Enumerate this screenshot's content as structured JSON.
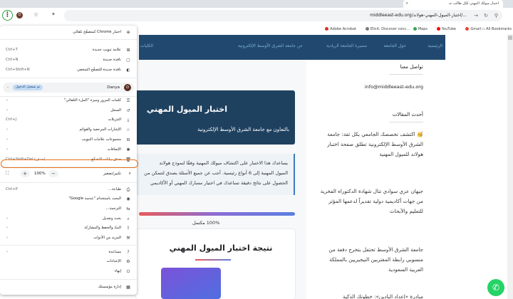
{
  "browser": {
    "tab_title": "اختبار ميولك المهني لكل طالب جـ",
    "tab_close": "×",
    "url": "middleeast-edu.org/اختبار-الميول-المهني-هولاند/...",
    "menu_icon": "⋮",
    "avatar_letter": "D",
    "bookmarks": [
      {
        "label": "All Bookmarks",
        "icon": "folder-icon"
      },
      {
        "label": "Gmail",
        "color": "#ea4335"
      },
      {
        "label": "YouTube",
        "color": "#ff0000"
      },
      {
        "label": "Maps",
        "color": "#34a853"
      },
      {
        "label": "Elicit: Discover conc...",
        "color": "#7a7a7a"
      },
      {
        "label": "Adobe Acrobat",
        "color": "#d93025"
      }
    ]
  },
  "site": {
    "nav": [
      "الرئيسية",
      "حول الجامعة",
      "مسيرة الجامعة الريادية",
      "عن جامعة الشرق الأوسط الإلكترونية",
      "الكليات"
    ],
    "hero_title": "اختبار الميول المهني",
    "hero_subtitle": "بالتعاون مع جامعة الشرق الأوسط الإلكترونية",
    "intro_lines": [
      "يساعدك هذا الاختبار على اكتشاف ميولك المهنية وفقًا لنموذج هولاند",
      "الميول المهنية إلى 6 أنواع رئيسية. أجب عن جميع الأسئلة بصدق لتتمكن من",
      "الحصول على نتائج دقيقة تساعدك في اختيار مسارك المهني أو الأكاديمي"
    ],
    "progress_label": "100% مكتمل",
    "progress_percent": 100,
    "result_title": "نتيجة اختبار الميول المهني"
  },
  "sidebar": {
    "contact_title": "تواصل معنا",
    "email": "info@middleeast-edu.org",
    "recent_title": "أحدث المقالات",
    "articles": [
      "🥳 اكتشف تخصصك الجامعي بكل ثقة: جامعة الشرق الأوسط الإلكترونية تطلق صفحة اختبار هولاند للميول المهنية",
      "جيهان عزي سوادي تنال شهادة الدكتوراه الفخرية من جهات أكاديمية دولية تقديراً لدعمها المؤثر للتعليم والأبحاث",
      "جامعة الشرق الأوسط تحتفل بتخرج دفعة من منسوبي رابطة المغتربين النيجيريين بالمملكة العربية السعودية",
      "مبادرة «إعداد البادين»: خطوتك الذكية"
    ]
  },
  "chrome_menu": {
    "items": [
      {
        "label": "اختيار Chrome كمتصفّح تلقائي",
        "icon": "⊕",
        "shortcut": ""
      },
      {
        "label": "علامة تبويب جديدة",
        "icon": "⊞",
        "shortcut": "Ctrl+T"
      },
      {
        "label": "نافذة جديدة",
        "icon": "▢",
        "shortcut": "Ctrl+N"
      },
      {
        "label": "نافذة جديدة للتصفّح المتخفي",
        "icon": "◐",
        "shortcut": "Ctrl+Shift+N"
      },
      {
        "label": "كلمات المرور وميزة \"الملء التلقائي\"",
        "icon": "⚿",
        "chev": "‹"
      },
      {
        "label": "السجل",
        "icon": "↺",
        "chev": "‹"
      },
      {
        "label": "التنزيلات",
        "icon": "⤓",
        "shortcut": "Ctrl+J"
      },
      {
        "label": "الإشارات المرجعية والقوائم",
        "icon": "☆",
        "chev": "‹"
      },
      {
        "label": "مجموعات علامات التبويب",
        "icon": "⊟",
        "chev": "‹"
      },
      {
        "label": "الإضافات",
        "icon": "✱",
        "chev": "‹"
      },
      {
        "label": "حذف بيانات التصفّح...",
        "icon": "🗑",
        "shortcut": "Ctrl+Shift+Del (حذف)"
      },
      {
        "label": "طباعة...",
        "icon": "⎙",
        "shortcut": "Ctrl+P"
      },
      {
        "label": "البحث باستخدام \"عدسة Google\"",
        "icon": "◉",
        "shortcut": ""
      },
      {
        "label": "الترجمة...",
        "icon": "⇆",
        "shortcut": ""
      },
      {
        "label": "بحث وتعديل",
        "icon": "⌕",
        "chev": "‹"
      },
      {
        "label": "البثّ والحفظ والمشاركة",
        "icon": "⇪",
        "chev": "‹"
      },
      {
        "label": "المزيد من الأدوات",
        "icon": "⚒",
        "chev": "‹"
      },
      {
        "label": "مساعدة",
        "icon": "?",
        "chev": "‹"
      },
      {
        "label": "الإعدادات",
        "icon": "⚙",
        "shortcut": ""
      },
      {
        "label": "إنهاء",
        "icon": "⏻",
        "shortcut": ""
      },
      {
        "label": "إدارة مؤسستك",
        "icon": "▦",
        "shortcut": ""
      }
    ],
    "profile": {
      "name": "Danya",
      "avatar": "D",
      "status": "تم تسجيل الدخول",
      "chev": "‹"
    },
    "zoom": {
      "label": "تكبير/تصغير",
      "value": "100%",
      "minus": "−",
      "plus": "+",
      "fullscreen": "⛶",
      "icon": "⌕"
    }
  },
  "whatsapp_icon": "✆"
}
